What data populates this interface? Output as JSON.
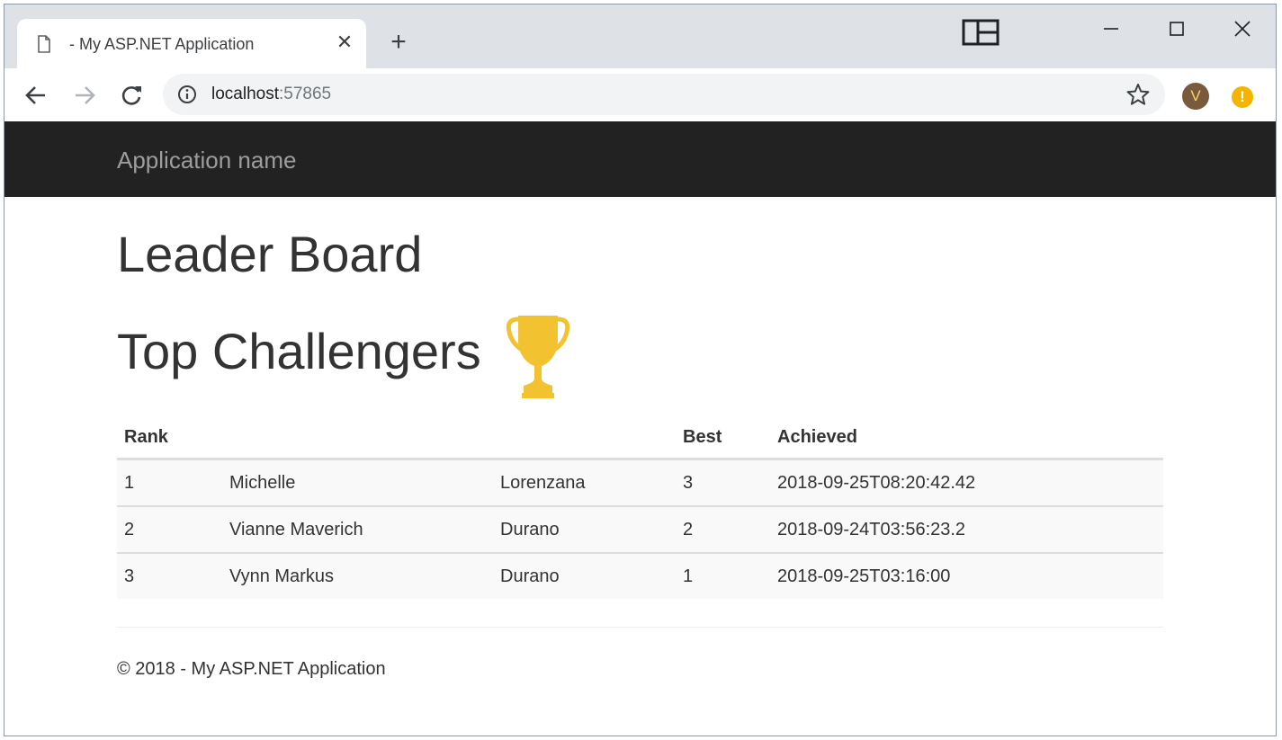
{
  "browser": {
    "tab_title": "- My ASP.NET Application",
    "tab_close_glyph": "✕",
    "new_tab_glyph": "+",
    "url_host": "localhost",
    "url_port": ":57865",
    "profile_initial": "V",
    "alert_glyph": "!",
    "icons": [
      "page-icon",
      "close-icon",
      "plus-icon",
      "tab-layout-icon",
      "minimize-icon",
      "maximize-icon",
      "window-close-icon",
      "back-arrow-icon",
      "forward-arrow-icon",
      "reload-icon",
      "info-icon",
      "star-icon",
      "profile-avatar",
      "alert-icon"
    ]
  },
  "navbar": {
    "brand": "Application name"
  },
  "page": {
    "title": "Leader Board",
    "subtitle": "Top Challengers",
    "trophy_color": "#f2c230",
    "table": {
      "headers": [
        "Rank",
        "",
        "",
        "Best",
        "Achieved"
      ],
      "rows": [
        [
          "1",
          "Michelle",
          "Lorenzana",
          "3",
          "2018-09-25T08:20:42.42"
        ],
        [
          "2",
          "Vianne Maverich",
          "Durano",
          "2",
          "2018-09-24T03:56:23.2"
        ],
        [
          "3",
          "Vynn Markus",
          "Durano",
          "1",
          "2018-09-25T03:16:00"
        ]
      ]
    },
    "footer": "© 2018 - My ASP.NET Application"
  },
  "colors": {
    "navbar_bg": "#222222",
    "brand_text": "#9d9d9d",
    "tabstrip_bg": "#dee1e6",
    "omnibox_bg": "#f1f3f4"
  }
}
